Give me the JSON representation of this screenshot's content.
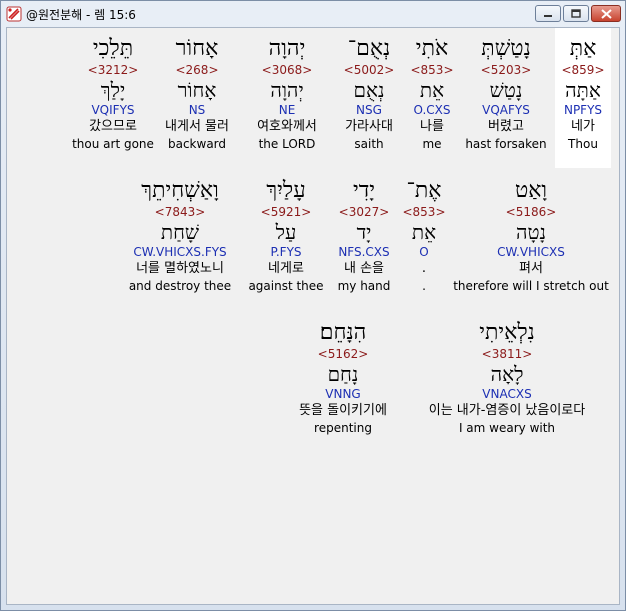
{
  "window": {
    "title": "@원전분해 - 렘 15:6"
  },
  "rows": [
    {
      "words": [
        {
          "heb": "תֵּלֵכִי",
          "strong": "<3212>",
          "lemma": "יָלַךְ",
          "morph": "VQIFYS",
          "kor": "갔으므로",
          "eng": "thou art gone"
        },
        {
          "heb": "אָחוֹר",
          "strong": "<268>",
          "lemma": "אָחוֹר",
          "morph": "NS",
          "kor": "내게서 물러",
          "eng": "backward"
        },
        {
          "heb": "יְהוָה",
          "strong": "<3068>",
          "lemma": "יְהוָה",
          "morph": "NE",
          "kor": "여호와께서",
          "eng": "the LORD"
        },
        {
          "heb": "נְאֻם־",
          "strong": "<5002>",
          "lemma": "נְאֻם",
          "morph": "NSG",
          "kor": "가라사대",
          "eng": "saith"
        },
        {
          "heb": "אֹתִי",
          "strong": "<853>",
          "lemma": "אֵת",
          "morph": "O.CXS",
          "kor": "나를",
          "eng": "me"
        },
        {
          "heb": "נָטַשְׁתְּ",
          "strong": "<5203>",
          "lemma": "נָטַשׁ",
          "morph": "VQAFYS",
          "kor": "버렸고",
          "eng": "hast forsaken"
        },
        {
          "heb": "אַתְּ",
          "strong": "<859>",
          "lemma": "אַתָּה",
          "morph": "NPFYS",
          "kor": "네가",
          "eng": "Thou"
        }
      ]
    },
    {
      "words": [
        {
          "heb": "וָאַשְׁחִיתֵךְ",
          "strong": "<7843>",
          "lemma": "שָׁחַת",
          "morph": "CW.VHICXS.FYS",
          "kor": "너를 멸하였노니",
          "eng": "and destroy thee"
        },
        {
          "heb": "עָלַיִךְ",
          "strong": "<5921>",
          "lemma": "עַל",
          "morph": "P.FYS",
          "kor": "네게로",
          "eng": "against thee"
        },
        {
          "heb": "יָדִי",
          "strong": "<3027>",
          "lemma": "יָד",
          "morph": "NFS.CXS",
          "kor": "내 손을",
          "eng": "my hand"
        },
        {
          "heb": "אֶת־",
          "strong": "<853>",
          "lemma": "אֵת",
          "morph": "O",
          "kor": ".",
          "eng": "."
        },
        {
          "heb": "וָאַט",
          "strong": "<5186>",
          "lemma": "נָטָה",
          "morph": "CW.VHICXS",
          "kor": "펴서",
          "eng": "therefore will I stretch out"
        }
      ]
    },
    {
      "words": [
        {
          "heb": "הִנָּחֵם׃",
          "strong": "<5162>",
          "lemma": "נָחַם",
          "morph": "VNNG",
          "kor": "뜻을 돌이키기에",
          "eng": "repenting"
        },
        {
          "heb": "נִלְאֵיתִי",
          "strong": "<3811>",
          "lemma": "לָאָה",
          "morph": "VNACXS",
          "kor": "이는 내가-염증이 났음이로다",
          "eng": "I am weary with"
        }
      ]
    }
  ],
  "colors": {
    "strong": "#8b1a1a",
    "morph": "#1c2fb3",
    "selected_bg": "#ffffff"
  }
}
